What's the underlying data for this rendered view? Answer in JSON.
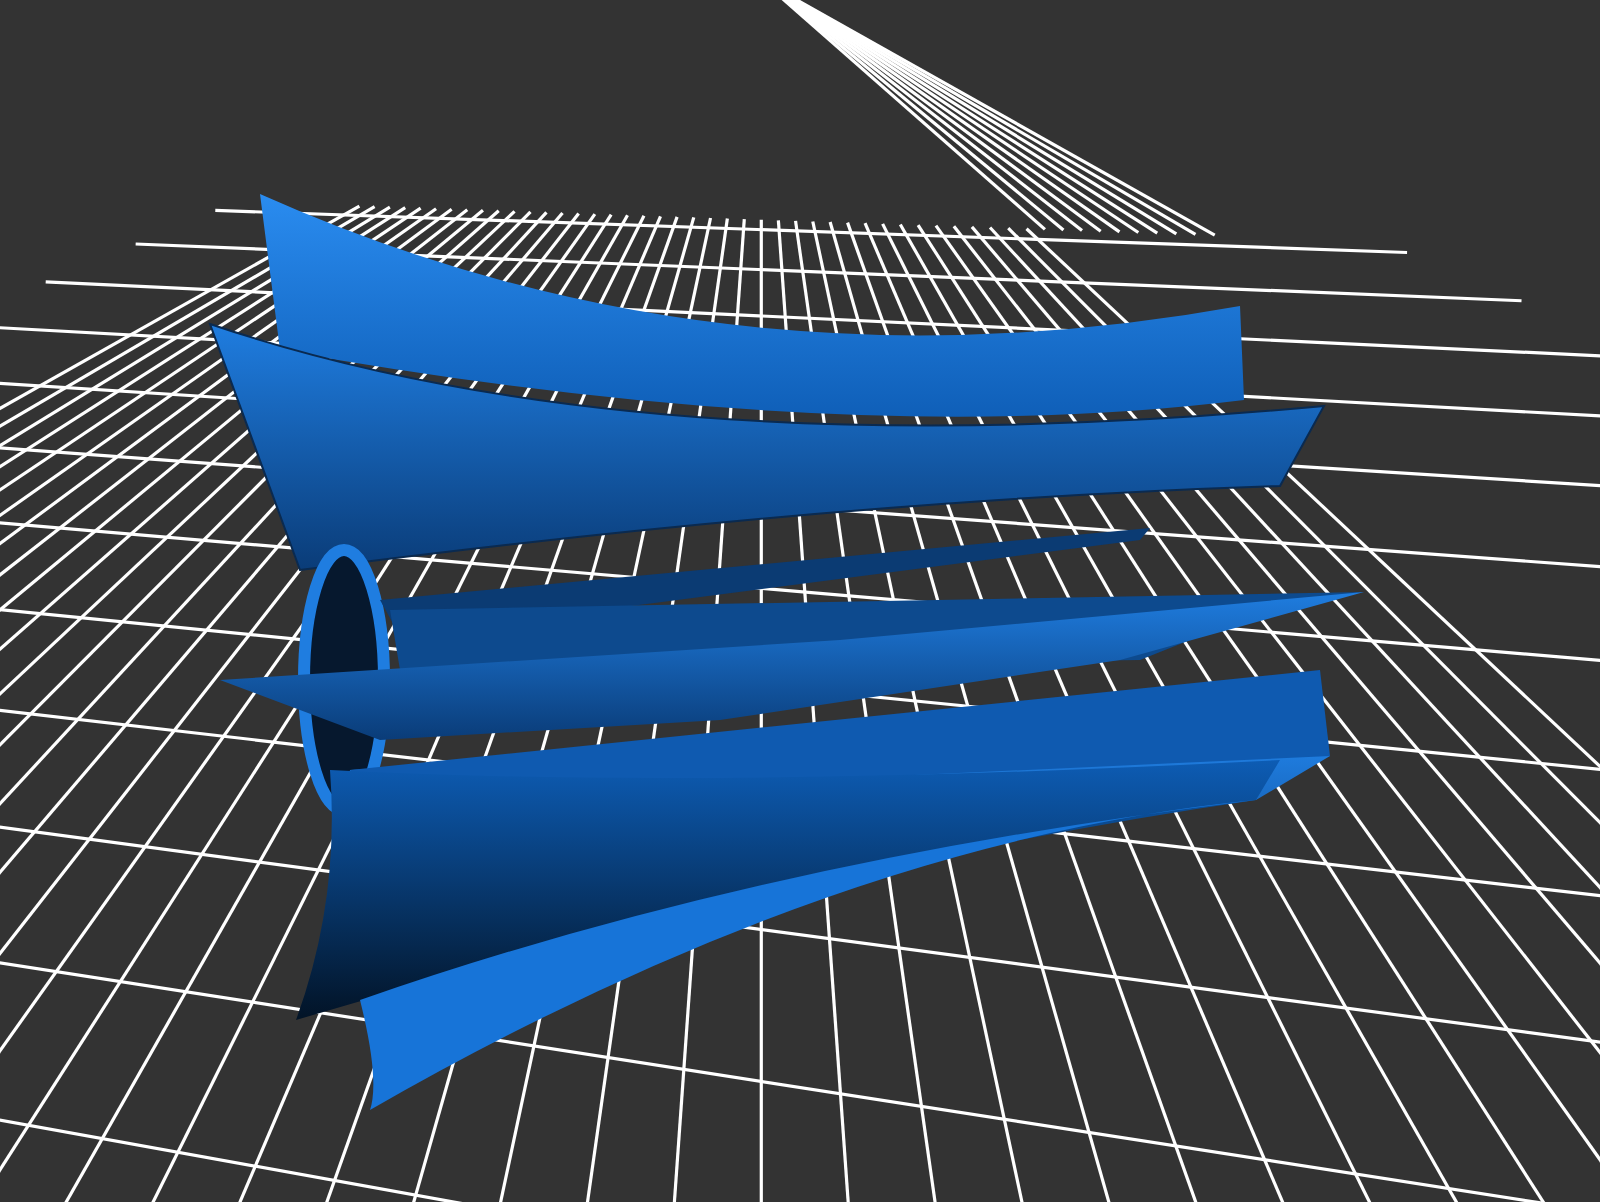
{
  "scene": {
    "kind": "render3d"
  }
}
